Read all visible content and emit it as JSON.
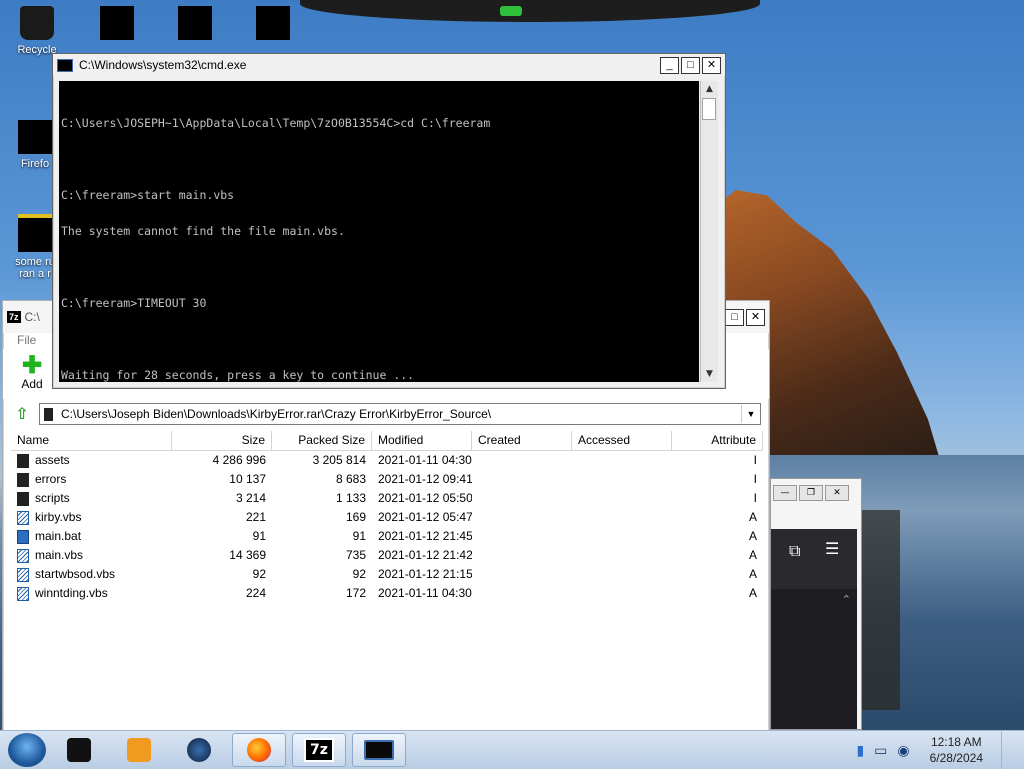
{
  "desktop": {
    "icons": [
      {
        "label": "Recycle"
      },
      {
        "label": "Firefo"
      },
      {
        "label": "some ru"
      },
      {
        "label": "ran a r"
      }
    ]
  },
  "cmd": {
    "title": "C:\\Windows\\system32\\cmd.exe",
    "lines": [
      "C:\\Users\\JOSEPH~1\\AppData\\Local\\Temp\\7zO0B13554C>cd C:\\freeram",
      "",
      "C:\\freeram>start main.vbs",
      "The system cannot find the file main.vbs.",
      "",
      "C:\\freeram>TIMEOUT 30",
      "",
      "Waiting for 28 seconds, press a key to continue ..."
    ]
  },
  "sevenzip": {
    "title": "C:\\",
    "icon_text": "7z",
    "menu_file": "File",
    "add_label": "Add",
    "path": "C:\\Users\\Joseph Biden\\Downloads\\KirbyError.rar\\Crazy Error\\KirbyError_Source\\",
    "columns": [
      "Name",
      "Size",
      "Packed Size",
      "Modified",
      "Created",
      "Accessed",
      "Attribute"
    ],
    "rows": [
      {
        "type": "folder",
        "name": "assets",
        "size": "4 286 996",
        "packed": "3 205 814",
        "modified": "2021-01-11 04:30",
        "attr": "I"
      },
      {
        "type": "folder",
        "name": "errors",
        "size": "10 137",
        "packed": "8 683",
        "modified": "2021-01-12 09:41",
        "attr": "I"
      },
      {
        "type": "folder",
        "name": "scripts",
        "size": "3 214",
        "packed": "1 133",
        "modified": "2021-01-12 05:50",
        "attr": "I"
      },
      {
        "type": "script",
        "name": "kirby.vbs",
        "size": "221",
        "packed": "169",
        "modified": "2021-01-12 05:47",
        "attr": "A"
      },
      {
        "type": "bat",
        "name": "main.bat",
        "size": "91",
        "packed": "91",
        "modified": "2021-01-12 21:45",
        "attr": "A"
      },
      {
        "type": "script",
        "name": "main.vbs",
        "size": "14 369",
        "packed": "735",
        "modified": "2021-01-12 21:42",
        "attr": "A"
      },
      {
        "type": "script",
        "name": "startwbsod.vbs",
        "size": "92",
        "packed": "92",
        "modified": "2021-01-12 21:15",
        "attr": "A"
      },
      {
        "type": "script",
        "name": "winntding.vbs",
        "size": "224",
        "packed": "172",
        "modified": "2021-01-11 04:30",
        "attr": "A"
      }
    ]
  },
  "taskbar": {
    "time": "12:18 AM",
    "date": "6/28/2024",
    "pinned": [
      "start-orb",
      "explorer",
      "media-player",
      "app-globe",
      "firefox",
      "7zip",
      "cmd"
    ]
  },
  "colors": {
    "cmd_bg": "#000000",
    "cmd_fg": "#c0c0c0",
    "add_green": "#1db41d"
  }
}
